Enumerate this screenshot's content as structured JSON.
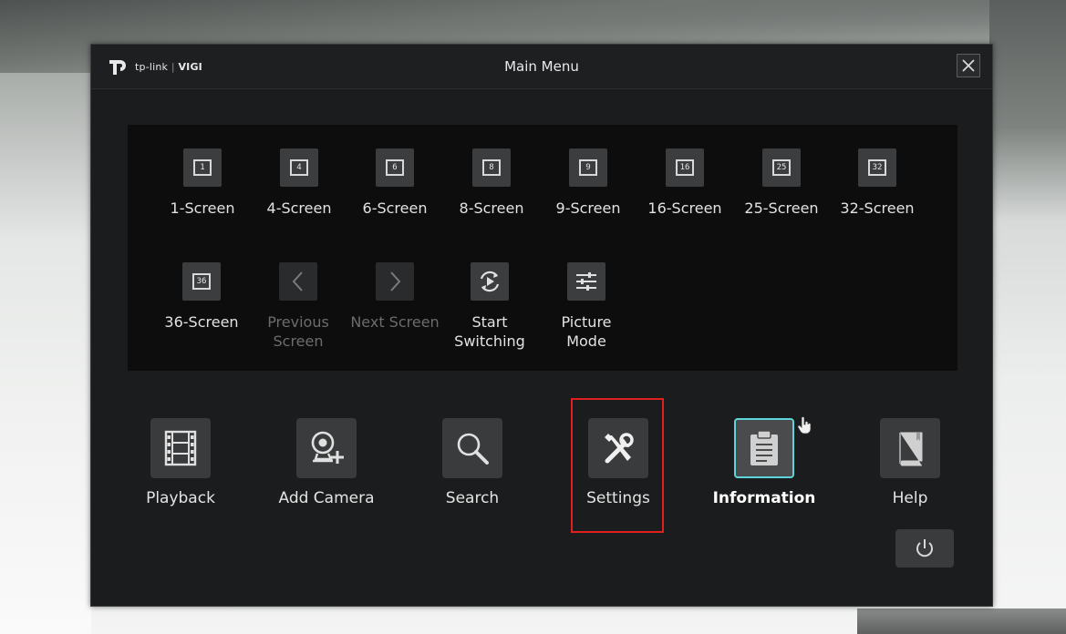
{
  "window": {
    "brand_name": "tp-link",
    "brand_product": "VIGI",
    "title": "Main Menu"
  },
  "screen_layouts": [
    {
      "label": "1-Screen",
      "glyph": "1",
      "icon": "layout-1-icon"
    },
    {
      "label": "4-Screen",
      "glyph": "4",
      "icon": "layout-4-icon"
    },
    {
      "label": "6-Screen",
      "glyph": "6",
      "icon": "layout-6-icon"
    },
    {
      "label": "8-Screen",
      "glyph": "8",
      "icon": "layout-8-icon"
    },
    {
      "label": "9-Screen",
      "glyph": "9",
      "icon": "layout-9-icon"
    },
    {
      "label": "16-Screen",
      "glyph": "16",
      "icon": "layout-16-icon"
    },
    {
      "label": "25-Screen",
      "glyph": "25",
      "icon": "layout-25-icon"
    },
    {
      "label": "32-Screen",
      "glyph": "32",
      "icon": "layout-32-icon"
    },
    {
      "label": "36-Screen",
      "glyph": "36",
      "icon": "layout-36-icon"
    }
  ],
  "screen_controls": {
    "previous_line1": "Previous",
    "previous_line2": "Screen",
    "next": "Next Screen",
    "start_line1": "Start",
    "start_line2": "Switching",
    "picture_line1": "Picture",
    "picture_line2": "Mode"
  },
  "main_actions": {
    "playback": "Playback",
    "add_camera": "Add Camera",
    "search": "Search",
    "settings": "Settings",
    "information": "Information",
    "help": "Help"
  },
  "colors": {
    "accent_active_border": "#5fd3da",
    "highlight_annotation": "#e0201f",
    "window_background": "#1b1c1d"
  }
}
